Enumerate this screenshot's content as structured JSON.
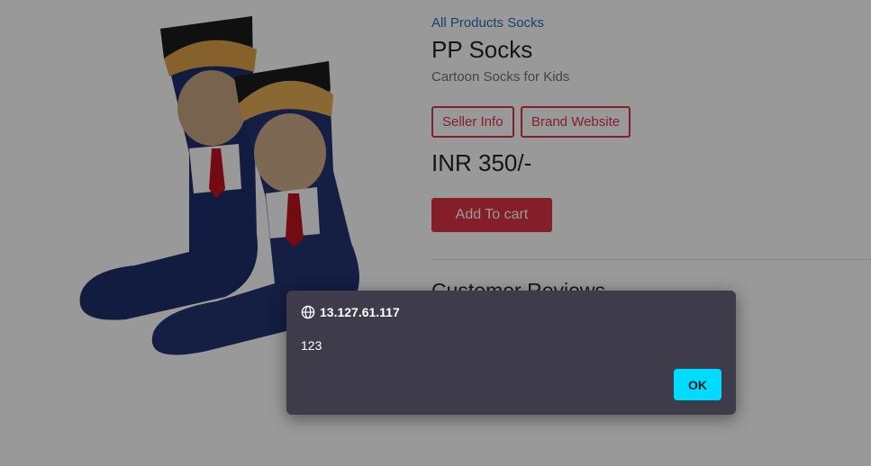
{
  "product": {
    "breadcrumb": "All Products Socks",
    "title": "PP Socks",
    "subtitle": "Cartoon Socks for Kids",
    "seller_button": "Seller Info",
    "brand_button": "Brand Website",
    "price": "INR 350/-",
    "add_to_cart": "Add To cart",
    "reviews_heading": "Customer Reviews"
  },
  "dialog": {
    "origin": "13.127.61.117",
    "message": "123",
    "ok_label": "OK",
    "icon": "globe-icon"
  },
  "colors": {
    "accent": "#dc3545",
    "link": "#2a6fb3",
    "dialog_bg": "#3e3c4a",
    "ok_button": "#00dcff"
  }
}
